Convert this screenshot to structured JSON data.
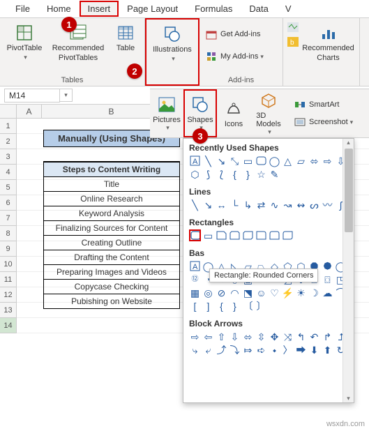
{
  "tabs": {
    "file": "File",
    "home": "Home",
    "insert": "Insert",
    "pagelayout": "Page Layout",
    "formulas": "Formulas",
    "data": "Data",
    "v": "V"
  },
  "ribbon": {
    "pivottable": "PivotTable",
    "recpivot": "Recommended\nPivotTables",
    "table": "Table",
    "illustrations": "Illustrations",
    "getaddins": "Get Add-ins",
    "myaddins": "My Add-ins",
    "recchart": "Recommended\nCharts",
    "group_tables": "Tables",
    "group_addins": "Add-ins"
  },
  "gallery": {
    "pictures": "Pictures",
    "shapes": "Shapes",
    "icons": "Icons",
    "models": "3D\nModels",
    "smartart": "SmartArt",
    "screenshot": "Screenshot"
  },
  "namebox": "M14",
  "columns": {
    "a": "A",
    "b": "B"
  },
  "rows": [
    "1",
    "2",
    "3",
    "4",
    "5",
    "6",
    "7",
    "8",
    "9",
    "10",
    "11",
    "12",
    "13",
    "14"
  ],
  "active_row": "14",
  "table": {
    "title": "Manually (Using Shapes)",
    "header": "Steps to Content Writing",
    "cells": [
      "Title",
      "Online Research",
      "Keyword Analysis",
      "Finalizing Sources for Content",
      "Creating Outline",
      "Drafting the Content",
      "Preparing Images and Videos",
      "Copycase Checking",
      "Pubishing on Website"
    ]
  },
  "shapes_panel": {
    "recent": "Recently Used Shapes",
    "lines": "Lines",
    "rectangles": "Rectangles",
    "basic_truncated": "Bas",
    "blockarrows": "Block Arrows"
  },
  "tooltip": "Rectangle: Rounded Corners",
  "badges": {
    "b1": "1",
    "b2": "2",
    "b3": "3"
  },
  "watermark": "wsxdn.com"
}
